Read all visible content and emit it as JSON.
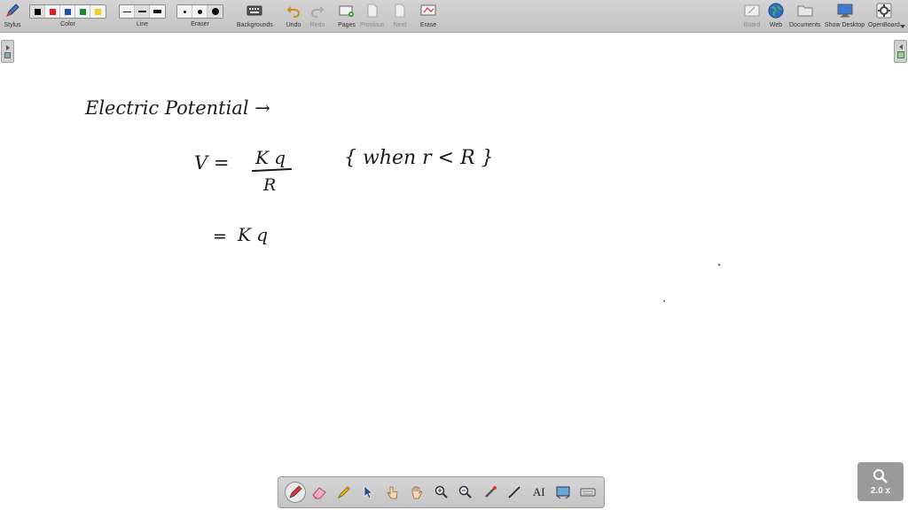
{
  "toolbar": {
    "stylus": "Stylus",
    "color": "Color",
    "line": "Line",
    "eraser": "Eraser",
    "backgrounds": "Backgrounds",
    "undo": "Undo",
    "redo": "Redo",
    "pages": "Pages",
    "previous": "Previous",
    "next": "Next",
    "erase": "Erase",
    "board": "Board",
    "web": "Web",
    "documents": "Documents",
    "show_desktop": "Show Desktop",
    "openboard": "OpenBoard"
  },
  "colors": {
    "palette": [
      "#000000",
      "#e21c1c",
      "#1f4fa5",
      "#1a8a2a",
      "#f2d01b"
    ],
    "toolbar_bg": "#c8c8c8"
  },
  "board_text": {
    "line1": "Electric  Potential →",
    "v_label": "V  =",
    "numerator": "K q",
    "denominator": "R",
    "condition": "{ when   r < R }",
    "line3_eq": "=",
    "line3_expr": "K q"
  },
  "zoom": {
    "label": "2.0 x"
  },
  "bottom_tools": {
    "text_tool": "AI"
  }
}
